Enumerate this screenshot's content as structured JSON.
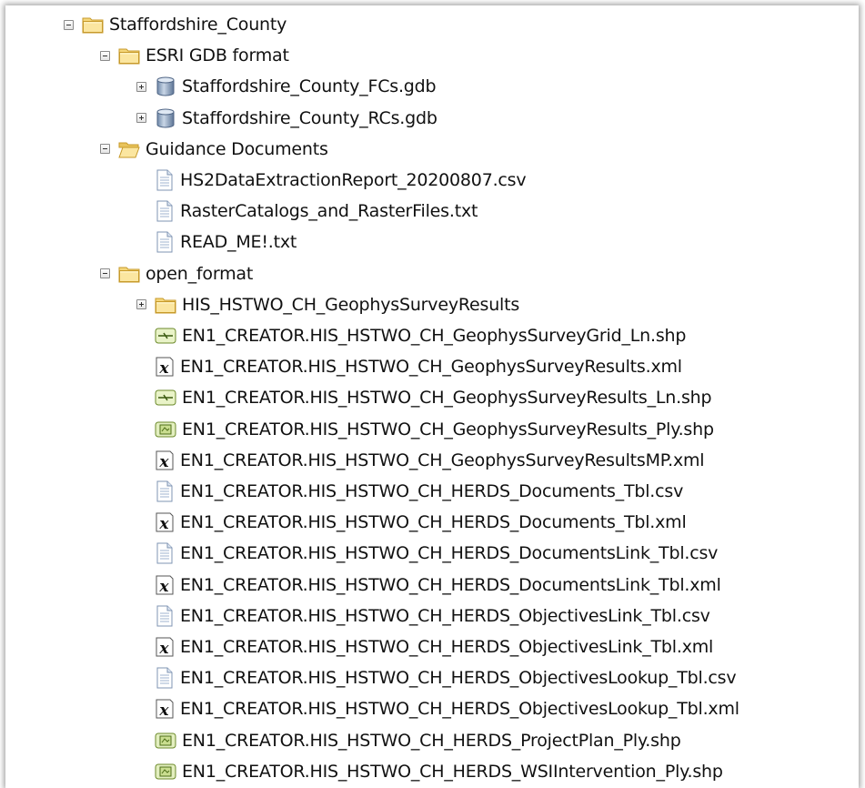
{
  "tree": [
    {
      "label": "Staffordshire_County",
      "icon": "folder-icon",
      "expander": "minus",
      "level": 0
    },
    {
      "label": "ESRI GDB format",
      "icon": "folder-icon",
      "expander": "minus",
      "level": 1
    },
    {
      "label": "Staffordshire_County_FCs.gdb",
      "icon": "geodatabase-icon",
      "expander": "plus",
      "level": 2
    },
    {
      "label": "Staffordshire_County_RCs.gdb",
      "icon": "geodatabase-icon",
      "expander": "plus",
      "level": 2
    },
    {
      "label": "Guidance Documents",
      "icon": "open-folder-icon",
      "expander": "minus",
      "level": 1
    },
    {
      "label": "HS2DataExtractionReport_20200807.csv",
      "icon": "document-icon",
      "expander": "none",
      "level": 2
    },
    {
      "label": "RasterCatalogs_and_RasterFiles.txt",
      "icon": "document-icon",
      "expander": "none",
      "level": 2
    },
    {
      "label": "READ_ME!.txt",
      "icon": "document-icon",
      "expander": "none",
      "level": 2
    },
    {
      "label": "open_format",
      "icon": "folder-icon",
      "expander": "minus",
      "level": 1
    },
    {
      "label": "HIS_HSTWO_CH_GeophysSurveyResults",
      "icon": "folder-icon",
      "expander": "plus",
      "level": 2
    },
    {
      "label": "EN1_CREATOR.HIS_HSTWO_CH_GeophysSurveyGrid_Ln.shp",
      "icon": "line-shapefile-icon",
      "expander": "none",
      "level": 2
    },
    {
      "label": "EN1_CREATOR.HIS_HSTWO_CH_GeophysSurveyResults.xml",
      "icon": "xml-icon",
      "expander": "none",
      "level": 2
    },
    {
      "label": "EN1_CREATOR.HIS_HSTWO_CH_GeophysSurveyResults_Ln.shp",
      "icon": "line-shapefile-icon",
      "expander": "none",
      "level": 2
    },
    {
      "label": "EN1_CREATOR.HIS_HSTWO_CH_GeophysSurveyResults_Ply.shp",
      "icon": "polygon-shapefile-icon",
      "expander": "none",
      "level": 2
    },
    {
      "label": "EN1_CREATOR.HIS_HSTWO_CH_GeophysSurveyResultsMP.xml",
      "icon": "xml-icon",
      "expander": "none",
      "level": 2
    },
    {
      "label": "EN1_CREATOR.HIS_HSTWO_CH_HERDS_Documents_Tbl.csv",
      "icon": "document-icon",
      "expander": "none",
      "level": 2
    },
    {
      "label": "EN1_CREATOR.HIS_HSTWO_CH_HERDS_Documents_Tbl.xml",
      "icon": "xml-icon",
      "expander": "none",
      "level": 2
    },
    {
      "label": "EN1_CREATOR.HIS_HSTWO_CH_HERDS_DocumentsLink_Tbl.csv",
      "icon": "document-icon",
      "expander": "none",
      "level": 2
    },
    {
      "label": "EN1_CREATOR.HIS_HSTWO_CH_HERDS_DocumentsLink_Tbl.xml",
      "icon": "xml-icon",
      "expander": "none",
      "level": 2
    },
    {
      "label": "EN1_CREATOR.HIS_HSTWO_CH_HERDS_ObjectivesLink_Tbl.csv",
      "icon": "document-icon",
      "expander": "none",
      "level": 2
    },
    {
      "label": "EN1_CREATOR.HIS_HSTWO_CH_HERDS_ObjectivesLink_Tbl.xml",
      "icon": "xml-icon",
      "expander": "none",
      "level": 2
    },
    {
      "label": "EN1_CREATOR.HIS_HSTWO_CH_HERDS_ObjectivesLookup_Tbl.csv",
      "icon": "document-icon",
      "expander": "none",
      "level": 2
    },
    {
      "label": "EN1_CREATOR.HIS_HSTWO_CH_HERDS_ObjectivesLookup_Tbl.xml",
      "icon": "xml-icon",
      "expander": "none",
      "level": 2
    },
    {
      "label": "EN1_CREATOR.HIS_HSTWO_CH_HERDS_ProjectPlan_Ply.shp",
      "icon": "polygon-shapefile-icon",
      "expander": "none",
      "level": 2
    },
    {
      "label": "EN1_CREATOR.HIS_HSTWO_CH_HERDS_WSIIntervention_Ply.shp",
      "icon": "polygon-shapefile-icon",
      "expander": "none",
      "level": 2
    }
  ]
}
